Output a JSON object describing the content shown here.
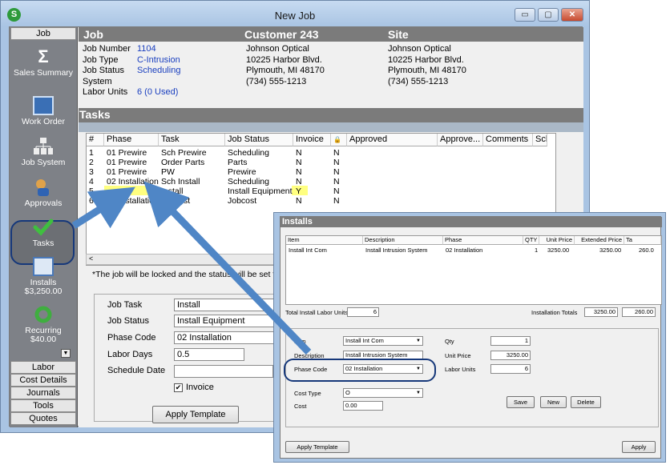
{
  "window": {
    "title": "New Job",
    "app_icon": "S",
    "minimize": "▭",
    "maximize": "▢",
    "close": "✕"
  },
  "nav": {
    "top_tab": "Job",
    "items": [
      {
        "label": "Sales Summary",
        "icon": "sigma-icon"
      },
      {
        "label": "Work Order",
        "icon": "work-order-icon"
      },
      {
        "label": "Job System",
        "icon": "job-system-icon"
      },
      {
        "label": "Approvals",
        "icon": "approvals-icon"
      },
      {
        "label": "Tasks",
        "icon": "check-icon"
      },
      {
        "label": "Installs",
        "sub": "$3,250.00",
        "icon": "installs-icon"
      },
      {
        "label": "Recurring",
        "sub": "$40.00",
        "icon": "recurring-icon"
      }
    ],
    "bottom_tabs": [
      "Labor",
      "Cost Details",
      "Journals",
      "Tools",
      "Quotes"
    ]
  },
  "header": {
    "job": "Job",
    "customer": "Customer 243",
    "site": "Site"
  },
  "job_info": {
    "job_number_label": "Job Number",
    "job_number": "1104",
    "job_type_label": "Job Type",
    "job_type": "C-Intrusion",
    "job_status_label": "Job Status",
    "job_status": "Scheduling",
    "system_label": "System",
    "labor_units_label": "Labor Units",
    "labor_units": "6 (0 Used)"
  },
  "customer_info": [
    "Johnson Optical",
    "10225 Harbor Blvd.",
    "Plymouth, MI  48170",
    "(734) 555-1213"
  ],
  "site_info": [
    "Johnson Optical",
    "10225 Harbor Blvd.",
    "Plymouth, MI  48170",
    "(734) 555-1213"
  ],
  "tasks": {
    "title": "Tasks",
    "columns": [
      "#",
      "Phase",
      "Task",
      "Job Status",
      "Invoice",
      "🔒",
      "Approved",
      "Approve...",
      "Comments",
      "Sch"
    ],
    "rows": [
      {
        "n": "1",
        "phase": "01 Prewire",
        "task": "Sch Prewire",
        "status": "Scheduling",
        "invoice": "N",
        "lock": "N"
      },
      {
        "n": "2",
        "phase": "01 Prewire",
        "task": "Order Parts",
        "status": "Parts",
        "invoice": "N",
        "lock": "N"
      },
      {
        "n": "3",
        "phase": "01 Prewire",
        "task": "PW",
        "status": "Prewire",
        "invoice": "N",
        "lock": "N"
      },
      {
        "n": "4",
        "phase": "02 Installation",
        "task": "Sch Install",
        "status": "Scheduling",
        "invoice": "N",
        "lock": "N"
      },
      {
        "n": "5",
        "phase": "02 Installation",
        "task": "Install",
        "status": "Install Equipment",
        "invoice": "Y",
        "lock": "N"
      },
      {
        "n": "6",
        "phase": "02 Installation",
        "task": "Jobcost",
        "status": "Jobcost",
        "invoice": "N",
        "lock": "N"
      }
    ],
    "note": "*The job will be locked and the status will be set to Job Co"
  },
  "task_form": {
    "job_task_label": "Job Task",
    "job_task": "Install",
    "job_status_label": "Job Status",
    "job_status": "Install Equipment",
    "phase_code_label": "Phase Code",
    "phase_code": "02 Installation",
    "labor_days_label": "Labor Days",
    "labor_days": "0.5",
    "schedule_date_label": "Schedule Date",
    "schedule_date": "",
    "invoice_label": "Invoice",
    "apply_template": "Apply Template"
  },
  "installs": {
    "title": "Installs",
    "columns": [
      "Item",
      "Description",
      "Phase",
      "QTY",
      "Unit Price",
      "Extended Price",
      "Ta"
    ],
    "rows": [
      {
        "item": "Install Int Com",
        "description": "Install Intrusion System",
        "phase": "02 Installation",
        "qty": "1",
        "unit_price": "3250.00",
        "extended": "3250.00",
        "tax": "260.0"
      }
    ],
    "total_labor_label": "Total Install Labor Units",
    "total_labor": "6",
    "totals_label": "Installation Totals",
    "total_price": "3250.00",
    "total_tax": "260.00",
    "item_label": "Item",
    "item": "Install Int Com",
    "description_label": "Description",
    "description": "Install Intrusion System",
    "phase_code_label": "Phase Code",
    "phase_code": "02 Installation",
    "qty_label": "Qty",
    "qty": "1",
    "unit_price_label": "Unit Price",
    "unit_price": "3250.00",
    "labor_units_label": "Labor Units",
    "labor_units": "6",
    "cost_type_label": "Cost Type",
    "cost_type": "O",
    "cost_label": "Cost",
    "cost": "0.00",
    "save": "Save",
    "new": "New",
    "delete": "Delete",
    "apply_template": "Apply Template",
    "apply": "Apply"
  },
  "colors": {
    "highlight": "#ffff80",
    "accent_blue": "#1a3fbf",
    "arrow": "#4f86c6",
    "oval": "#16387a"
  }
}
